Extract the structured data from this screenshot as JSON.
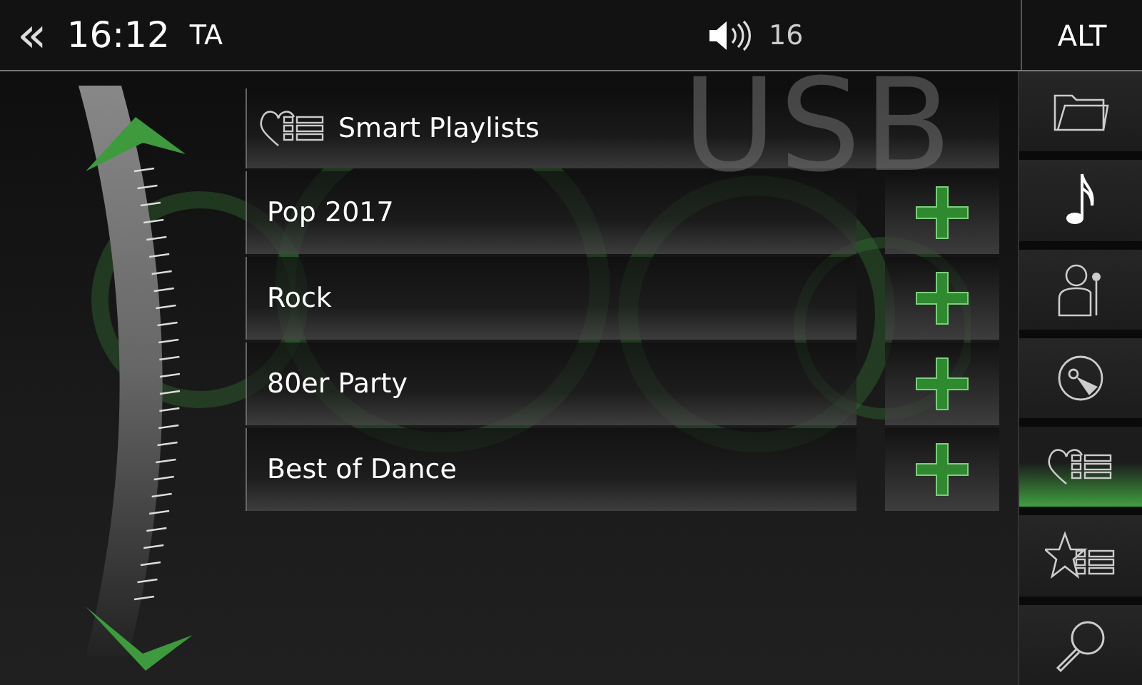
{
  "status_bar": {
    "back": "«",
    "time": "16:12",
    "ta": "TA",
    "volume": "16",
    "alt": "ALT"
  },
  "source_label": "USB",
  "list": {
    "title": "Smart Playlists",
    "items": [
      {
        "name": "Pop 2017"
      },
      {
        "name": "Rock"
      },
      {
        "name": "80er Party"
      },
      {
        "name": "Best of Dance"
      }
    ]
  },
  "sidebar": {
    "items": [
      {
        "kind": "folder",
        "selected": false
      },
      {
        "kind": "note",
        "selected": false
      },
      {
        "kind": "artist",
        "selected": false
      },
      {
        "kind": "disc",
        "selected": false
      },
      {
        "kind": "heart-list",
        "selected": true
      },
      {
        "kind": "star-list",
        "selected": false
      },
      {
        "kind": "search",
        "selected": false
      }
    ]
  }
}
